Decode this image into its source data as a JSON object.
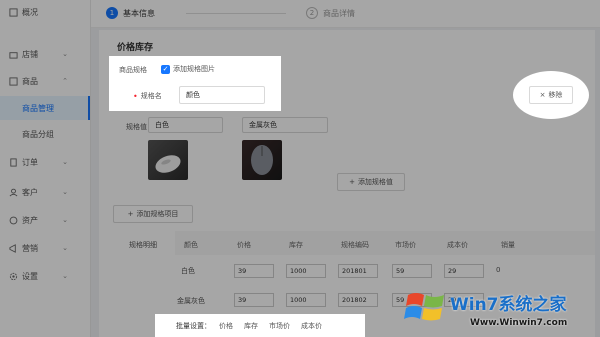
{
  "sidebar": {
    "items": [
      {
        "label": "概况",
        "icon": "home-icon"
      },
      {
        "label": "店铺",
        "icon": "shop-icon",
        "chevron": "⌄"
      },
      {
        "label": "商品",
        "icon": "goods-icon",
        "chevron": "⌃"
      },
      {
        "label": "商品管理"
      },
      {
        "label": "商品分组"
      },
      {
        "label": "订单",
        "icon": "order-icon",
        "chevron": "⌄"
      },
      {
        "label": "客户",
        "icon": "customer-icon",
        "chevron": "⌄"
      },
      {
        "label": "资产",
        "icon": "asset-icon",
        "chevron": "⌄"
      },
      {
        "label": "营销",
        "icon": "marketing-icon",
        "chevron": "⌄"
      },
      {
        "label": "设置",
        "icon": "settings-icon",
        "chevron": "⌄"
      }
    ]
  },
  "steps": [
    {
      "num": "1",
      "label": "基本信息"
    },
    {
      "num": "2",
      "label": "商品详情"
    }
  ],
  "section": {
    "title": "价格库存"
  },
  "spec": {
    "label": "商品规格",
    "checkbox_label": "添加规格图片",
    "name_label": "规格名",
    "name_value": "颜色",
    "remove_label": "移除",
    "value_label": "规格值",
    "values": [
      "白色",
      "金属灰色"
    ],
    "add_value_label": "添加规格值",
    "add_item_label": "添加规格项目"
  },
  "table": {
    "label": "规格明细",
    "headers": [
      "颜色",
      "价格",
      "库存",
      "规格编码",
      "市场价",
      "成本价",
      "销量"
    ],
    "rows": [
      {
        "color": "白色",
        "price": "39",
        "stock": "1000",
        "code": "201801",
        "market": "59",
        "cost": "29",
        "sales": "0"
      },
      {
        "color": "金属灰色",
        "price": "39",
        "stock": "1000",
        "code": "201802",
        "market": "59",
        "cost": "29"
      }
    ]
  },
  "batch": {
    "label": "批量设置：",
    "options": [
      "价格",
      "库存",
      "市场价",
      "成本价"
    ]
  },
  "watermark": {
    "brand": "Win7系统之家",
    "url": "Www.Winwin7.com"
  },
  "colors": {
    "accent": "#1677ff",
    "required": "#f5222d"
  }
}
